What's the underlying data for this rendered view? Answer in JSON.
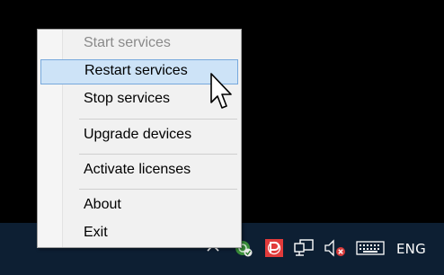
{
  "menu": {
    "items": [
      {
        "label": "Start services",
        "state": "disabled"
      },
      {
        "label": "Restart services",
        "state": "highlighted"
      },
      {
        "label": "Stop services",
        "state": "normal"
      },
      {
        "label": "Upgrade devices",
        "state": "normal"
      },
      {
        "label": "Activate licenses",
        "state": "normal"
      },
      {
        "label": "About",
        "state": "normal"
      },
      {
        "label": "Exit",
        "state": "normal"
      }
    ]
  },
  "taskbar": {
    "language": "ENG",
    "tray_icons": [
      "chevron-up-icon",
      "green-app-icon",
      "red-app-icon",
      "network-icon",
      "volume-muted-icon",
      "keyboard-icon"
    ]
  },
  "colors": {
    "taskbar_bg": "#0d1f33",
    "menu_bg": "#f1f1f1",
    "highlight_bg": "#cde3f7",
    "highlight_border": "#76a8dc",
    "disabled_text": "#8a8a8a"
  }
}
